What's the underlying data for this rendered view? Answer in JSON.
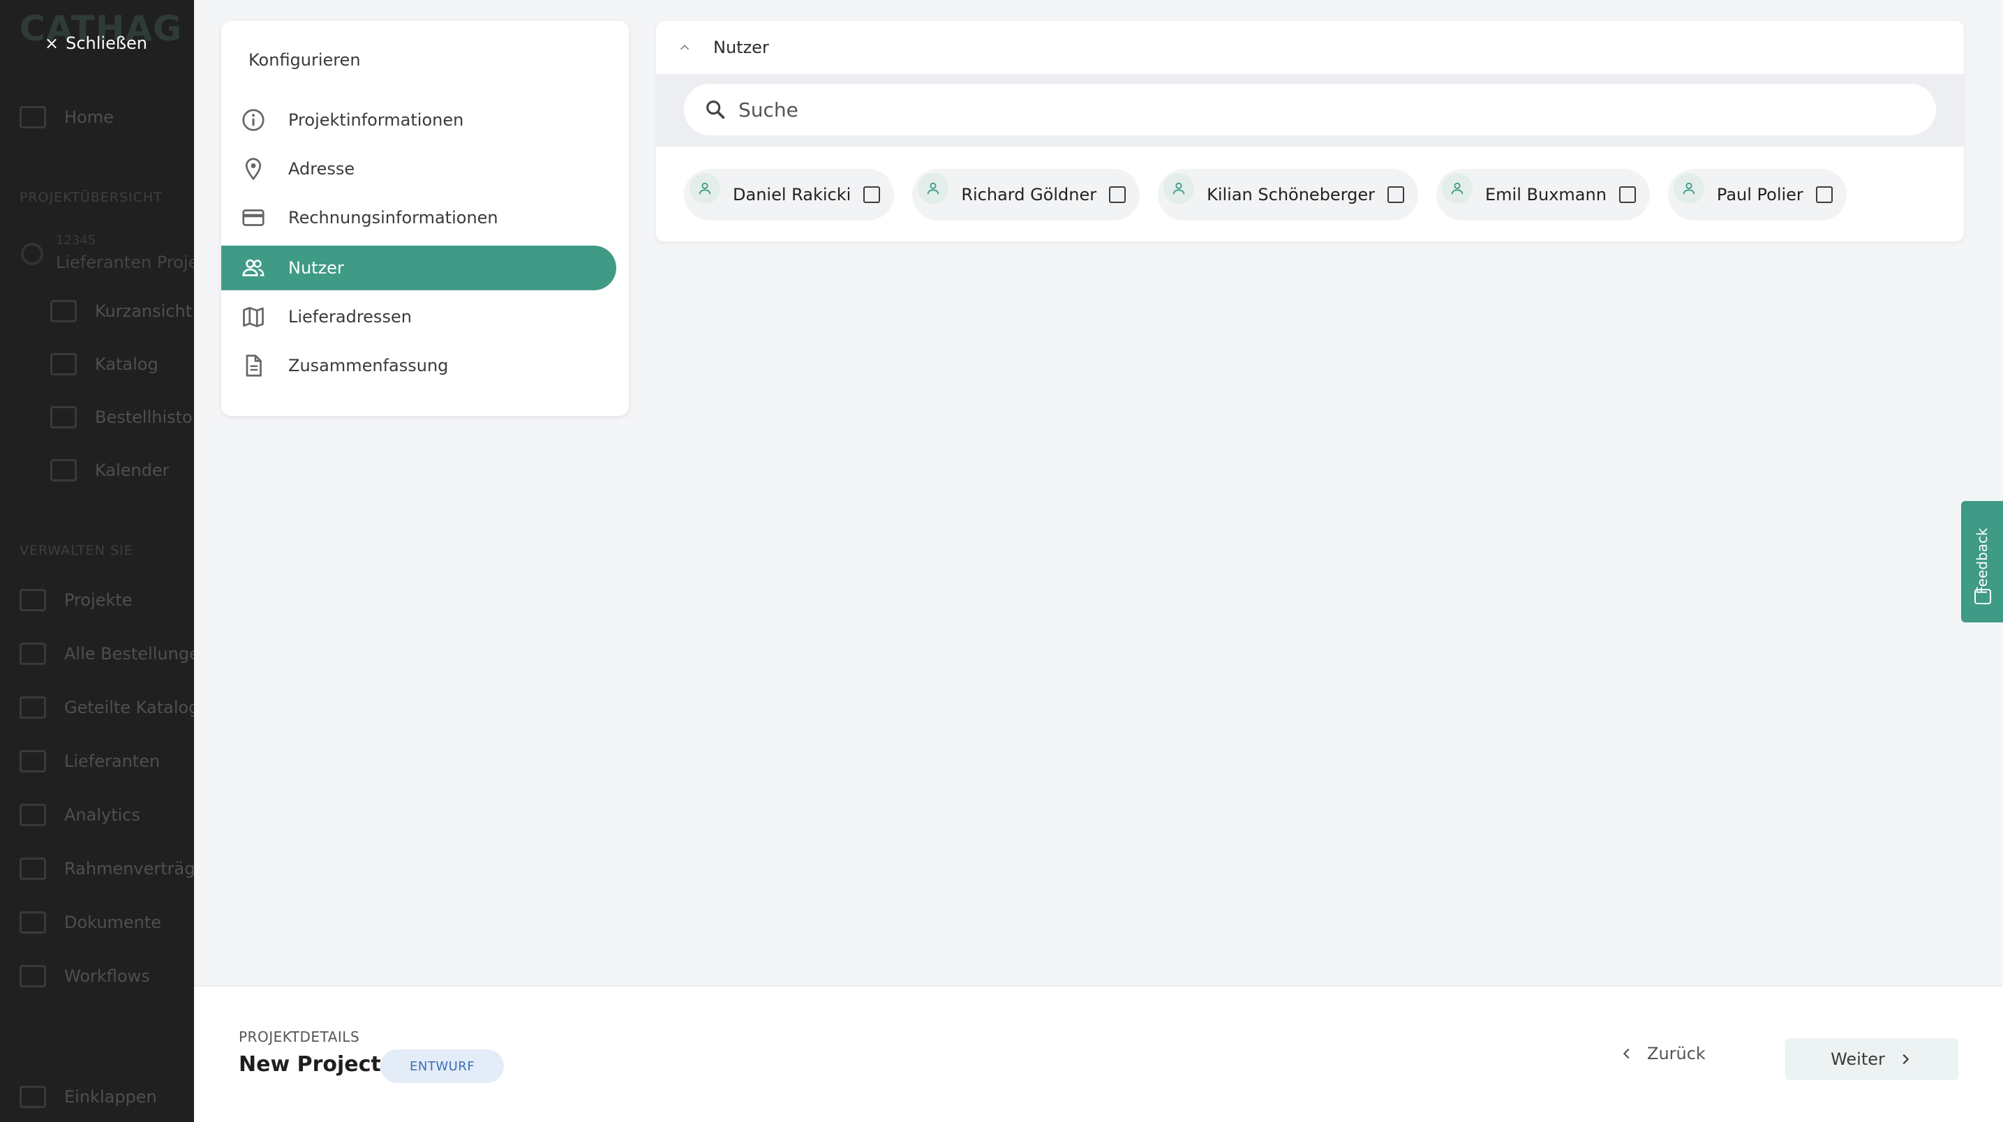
{
  "background": {
    "logo": "CATHAG",
    "close_label": "Schließen",
    "home": "Home",
    "section_overview": "PROJEKTÜBERSICHT",
    "project_number": "12345",
    "project_name": "Lieferanten Projekt",
    "project_items": [
      "Kurzansicht",
      "Katalog",
      "Bestellhistorie",
      "Kalender"
    ],
    "section_manage": "VERWALTEN SIE",
    "manage_items": [
      "Projekte",
      "Alle Bestellungen",
      "Geteilte Kataloge",
      "Lieferanten",
      "Analytics",
      "Rahmenverträge",
      "Dokumente",
      "Workflows"
    ],
    "collapse": "Einklappen"
  },
  "config": {
    "title": "Konfigurieren",
    "items": [
      {
        "label": "Projektinformationen",
        "icon": "info-icon"
      },
      {
        "label": "Adresse",
        "icon": "location-pin-icon"
      },
      {
        "label": "Rechnungsinformationen",
        "icon": "credit-card-icon"
      },
      {
        "label": "Nutzer",
        "icon": "users-icon",
        "active": true
      },
      {
        "label": "Lieferadressen",
        "icon": "map-icon"
      },
      {
        "label": "Zusammenfassung",
        "icon": "document-icon"
      }
    ]
  },
  "users": {
    "header": "Nutzer",
    "search_placeholder": "Suche",
    "people": [
      "Daniel Rakicki",
      "Richard Göldner",
      "Kilian Schöneberger",
      "Emil Buxmann",
      "Paul Polier"
    ]
  },
  "footer": {
    "label": "PROJEKTDETAILS",
    "title": "New Project",
    "badge": "ENTWURF",
    "back": "Zurück",
    "next": "Weiter"
  },
  "feedback": "Feedback",
  "colors": {
    "accent": "#3f9a86",
    "badge_bg": "#e4ecf8",
    "badge_text": "#3c6fb8"
  }
}
